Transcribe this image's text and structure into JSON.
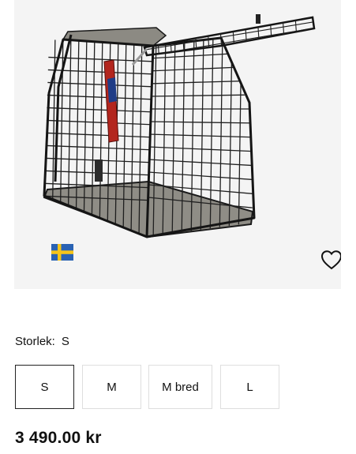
{
  "product": {
    "flag_icon": "sweden-flag-icon",
    "wishlist_icon": "heart-icon",
    "flag_colors": {
      "blue": "#2a62b3",
      "yellow": "#f6c51a"
    }
  },
  "size_selector": {
    "label": "Storlek:",
    "selected_value": "S",
    "options": [
      {
        "label": "S",
        "selected": true
      },
      {
        "label": "M",
        "selected": false
      },
      {
        "label": "M bred",
        "selected": false
      },
      {
        "label": "L",
        "selected": false
      }
    ]
  },
  "price": "3 490.00 kr"
}
